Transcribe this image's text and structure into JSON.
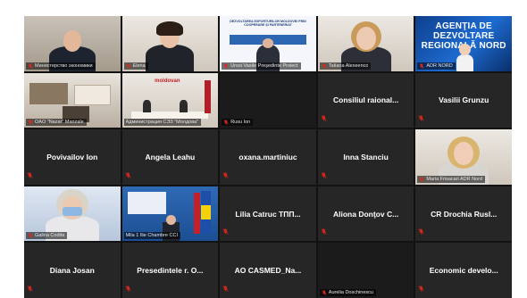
{
  "colors": {
    "grid_bg": "#121212",
    "tile_bg": "#262626",
    "active_border": "#d6c400",
    "mic_muted": "#e2261c",
    "agency_blue": "#1d6bd1"
  },
  "tiles": [
    {
      "name": "Министерство экономики",
      "label": "Министерство экономики",
      "type": "video",
      "muted": true,
      "scene": "office-man"
    },
    {
      "name": "Elena",
      "label": "Elena",
      "type": "video",
      "muted": true,
      "scene": "woman-glasses"
    },
    {
      "name": "Vasile Ursoi",
      "label": "Ursoi Vasile Preşedinte Proiect",
      "type": "doc",
      "muted": true,
      "scene": "document",
      "doc_heading": "DEZVOLTAREA EXPORTURILOR MOLDOVEI PRIN COOPERARE ŞI PARTENERIAT"
    },
    {
      "name": "Tatiana Alexeenco",
      "label": "Tatiana Alexeenco",
      "type": "video",
      "muted": true,
      "scene": "woman-blonde"
    },
    {
      "name": "ADR NORD",
      "label": "ADR NORD",
      "type": "agency",
      "muted": true,
      "scene": "agency",
      "banner": "AGENŢIA DE DEZVOLTARE REGIONALĂ NORD"
    },
    {
      "name": "OAO Naza Manzale",
      "label": "OAO \"Nazar\" Manzale",
      "type": "video",
      "muted": true,
      "scene": "office-shelves"
    },
    {
      "name": "Администрация СЭЗ",
      "label": "Администрация СЭЗ \"Молдова\"",
      "type": "video",
      "muted": false,
      "scene": "meeting-room",
      "room_sign": "moldovan"
    },
    {
      "name": "Rusu Ion",
      "label": "Rusu Ion",
      "type": "dark",
      "muted": true
    },
    {
      "name": "Consiliul raional...",
      "label": "",
      "type": "text",
      "muted": true
    },
    {
      "name": "Vasilii Grunzu",
      "label": "",
      "type": "text",
      "muted": true
    },
    {
      "name": "Povivailov Ion",
      "label": "",
      "type": "text",
      "muted": true
    },
    {
      "name": "Angela Leahu",
      "label": "",
      "type": "text",
      "muted": true
    },
    {
      "name": "oxana.martiniuc",
      "label": "",
      "type": "text",
      "muted": true
    },
    {
      "name": "Inna Stanciu",
      "label": "",
      "type": "text",
      "muted": true
    },
    {
      "name": "Maria Frisacari ADR Nord",
      "label": "Maria Frisacari ADR Nord",
      "type": "video",
      "muted": true,
      "scene": "woman-blonde2"
    },
    {
      "name": "Galina Codita",
      "label": "Galina Codita",
      "type": "video",
      "muted": true,
      "scene": "woman-mask"
    },
    {
      "name": "Mila 1 Ilie Chambre CCI",
      "label": "Mila 1 Ilie Chambre CCI",
      "type": "video",
      "muted": false,
      "active": true,
      "scene": "podium"
    },
    {
      "name": "Lilia Catruc ТПП...",
      "label": "",
      "type": "text",
      "muted": true
    },
    {
      "name": "Aliona Donţov C...",
      "label": "",
      "type": "text",
      "muted": true
    },
    {
      "name": "CR Drochia Rusl...",
      "label": "",
      "type": "text",
      "muted": true
    },
    {
      "name": "Diana Josan",
      "label": "",
      "type": "text",
      "muted": true
    },
    {
      "name": "Presedintele r. O...",
      "label": "",
      "type": "text",
      "muted": true
    },
    {
      "name": "AO CASMED_Na...",
      "label": "",
      "type": "text",
      "muted": true
    },
    {
      "name": "Aurelia Doschinescu",
      "label": "Aurelia Doschinescu",
      "type": "dark",
      "muted": true
    },
    {
      "name": "Economic develo...",
      "label": "",
      "type": "text",
      "muted": true
    }
  ]
}
